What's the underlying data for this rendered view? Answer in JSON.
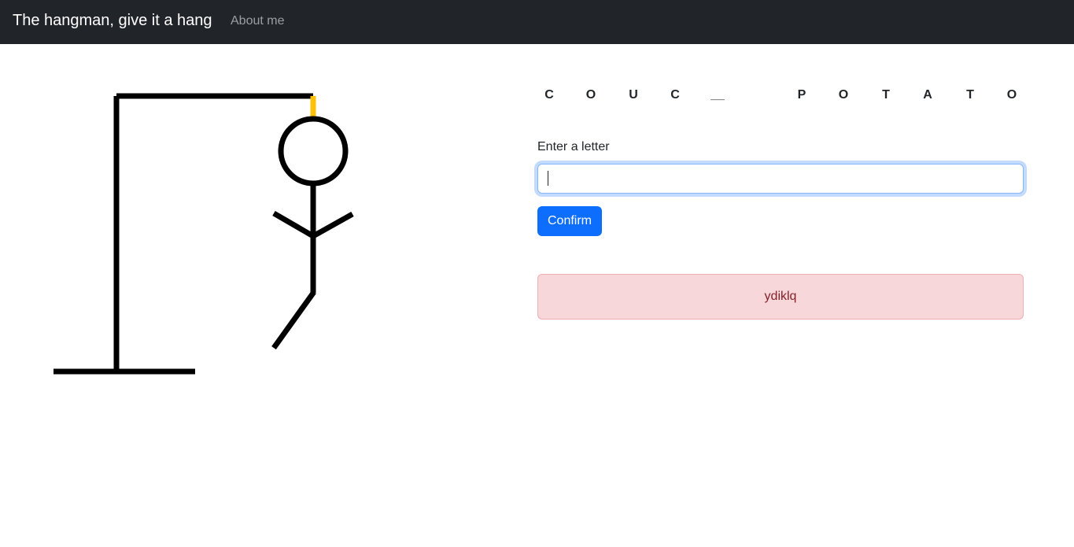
{
  "navbar": {
    "brand": "The hangman, give it a hang",
    "about_link": "About me"
  },
  "word": {
    "slots": [
      "C",
      "O",
      "U",
      "C",
      "__",
      "",
      "P",
      "O",
      "T",
      "A",
      "T",
      "O"
    ]
  },
  "form": {
    "label": "Enter a letter",
    "input_value": "",
    "confirm_label": "Confirm"
  },
  "wrong_letters": "ydiklq",
  "colors": {
    "navbar_bg": "#212529",
    "accent": "#0d6efd",
    "alert_bg": "#f8d7da",
    "alert_text": "#842029",
    "rope": "#ffc107"
  }
}
